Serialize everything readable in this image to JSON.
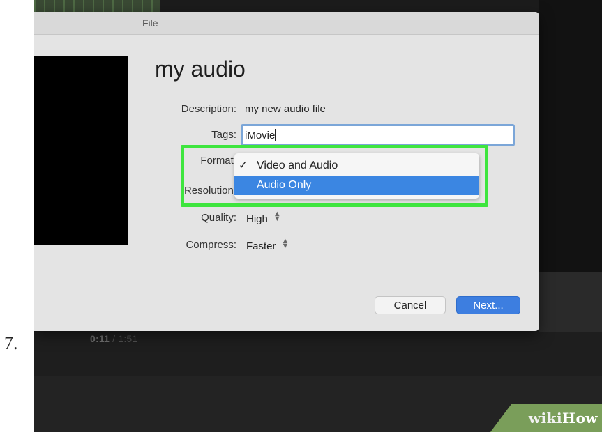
{
  "step": {
    "number": "7."
  },
  "dialog": {
    "title": "File",
    "project_name": "my audio",
    "fields": {
      "description_label": "Description:",
      "description_value": "my new audio file",
      "tags_label": "Tags:",
      "tags_value": "iMovie",
      "format_label": "Format:",
      "resolution_label": "Resolution:",
      "quality_label": "Quality:",
      "quality_value": "High",
      "compress_label": "Compress:",
      "compress_value": "Faster"
    },
    "format_popup": {
      "options": [
        {
          "label": "Video and Audio",
          "checked": true,
          "highlighted": false
        },
        {
          "label": "Audio Only",
          "checked": false,
          "highlighted": true
        }
      ],
      "check_glyph": "✓"
    },
    "buttons": {
      "cancel": "Cancel",
      "next": "Next..."
    }
  },
  "timeline": {
    "current": "0:11",
    "separator": " / ",
    "total": "1:51"
  },
  "watermark": {
    "part1": "wiki",
    "part2": "How"
  },
  "colors": {
    "highlight_box": "#3ee53e",
    "accent_blue": "#3b86e2",
    "dialog_bg": "#e4e4e4",
    "background": "#1c1c1c"
  }
}
